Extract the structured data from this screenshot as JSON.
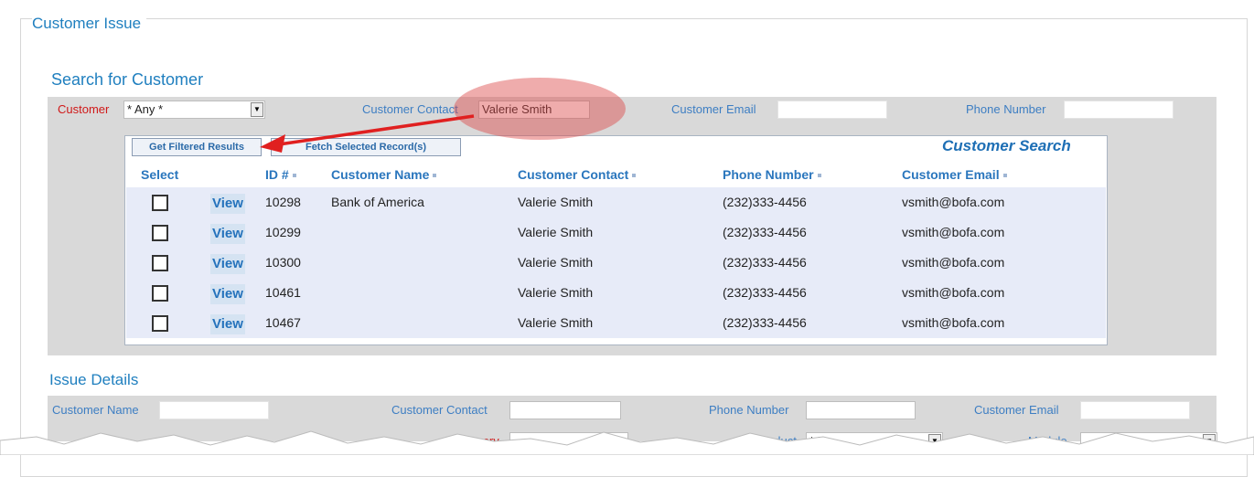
{
  "page": {
    "title": "Customer Issue"
  },
  "search": {
    "title": "Search for Customer",
    "customer_label": "Customer",
    "customer_value": "* Any *",
    "contact_label": "Customer Contact",
    "contact_value": "Valerie Smith",
    "email_label": "Customer Email",
    "email_value": "",
    "phone_label": "Phone Number",
    "phone_value": ""
  },
  "results": {
    "get_filtered_label": "Get Filtered Results",
    "fetch_selected_label": "Fetch Selected Record(s)",
    "panel_title": "Customer Search",
    "headers": {
      "select": "Select",
      "id": "ID #",
      "name": "Customer Name",
      "contact": "Customer Contact",
      "phone": "Phone Number",
      "email": "Customer Email"
    },
    "view_label": "View",
    "rows": [
      {
        "id": "10298",
        "name": "Bank of America",
        "contact": "Valerie Smith",
        "phone": "(232)333-4456",
        "email": "vsmith@bofa.com"
      },
      {
        "id": "10299",
        "name": "",
        "contact": "Valerie Smith",
        "phone": "(232)333-4456",
        "email": "vsmith@bofa.com"
      },
      {
        "id": "10300",
        "name": "",
        "contact": "Valerie Smith",
        "phone": "(232)333-4456",
        "email": "vsmith@bofa.com"
      },
      {
        "id": "10461",
        "name": "",
        "contact": "Valerie Smith",
        "phone": "(232)333-4456",
        "email": "vsmith@bofa.com"
      },
      {
        "id": "10467",
        "name": "",
        "contact": "Valerie Smith",
        "phone": "(232)333-4456",
        "email": "vsmith@bofa.com"
      }
    ]
  },
  "details": {
    "title": "Issue Details",
    "name_label": "Customer Name",
    "contact_label": "Customer Contact",
    "phone_label": "Phone Number",
    "email_label": "Customer Email",
    "category_label": "Category",
    "product_label": "Product",
    "product_value": "* I",
    "module_label": "Module"
  },
  "colors": {
    "accent": "#1f7fbf",
    "required": "#d01818",
    "annotation": "#e02020",
    "row_bg": "#e7ebf8"
  }
}
